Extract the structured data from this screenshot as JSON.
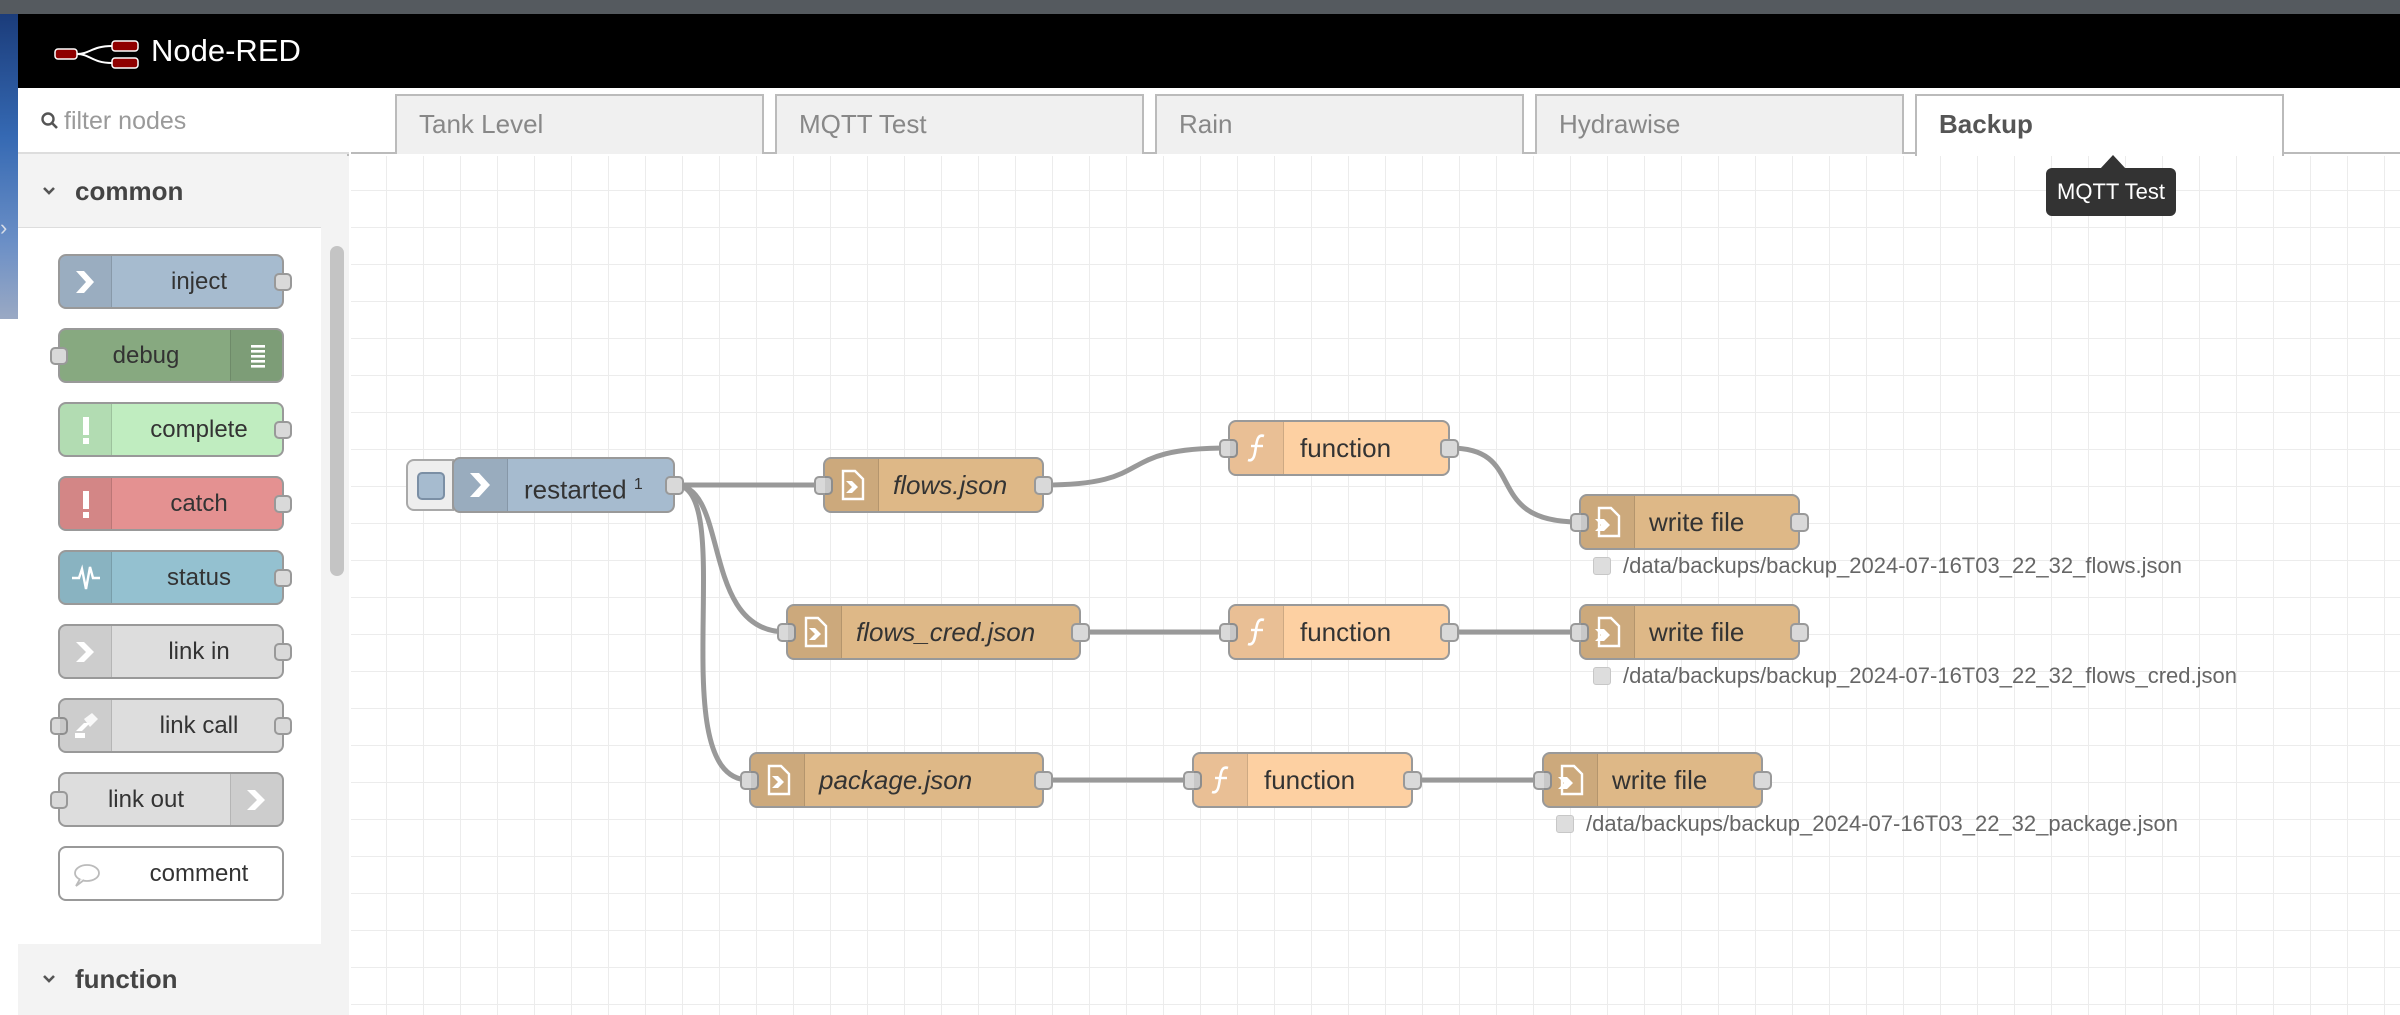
{
  "app": {
    "title": "Node-RED"
  },
  "palette": {
    "filter_placeholder": "filter nodes",
    "categories": [
      {
        "label": "common"
      },
      {
        "label": "function"
      }
    ],
    "nodes": [
      {
        "label": "inject",
        "color": "#a6bbcf",
        "icon": "arrow-in-icon"
      },
      {
        "label": "debug",
        "color": "#87a980",
        "icon": "list-icon"
      },
      {
        "label": "complete",
        "color": "#c0edc0",
        "icon": "exclamation-icon"
      },
      {
        "label": "catch",
        "color": "#e49191",
        "icon": "exclamation-icon"
      },
      {
        "label": "status",
        "color": "#94c1d0",
        "icon": "pulse-icon"
      },
      {
        "label": "link in",
        "color": "#dddddd",
        "icon": "link-in-icon"
      },
      {
        "label": "link call",
        "color": "#dddddd",
        "icon": "link-call-icon"
      },
      {
        "label": "link out",
        "color": "#dddddd",
        "icon": "link-out-icon"
      },
      {
        "label": "comment",
        "color": "#ffffff",
        "icon": "speech-bubble-icon"
      }
    ]
  },
  "tabs": [
    {
      "label": "Tank Level",
      "active": false
    },
    {
      "label": "MQTT Test",
      "active": false
    },
    {
      "label": "Rain",
      "active": false
    },
    {
      "label": "Hydrawise",
      "active": false
    },
    {
      "label": "Backup",
      "active": true
    }
  ],
  "tooltip": {
    "text": "MQTT Test"
  },
  "flow": {
    "nodes": [
      {
        "id": "restarted",
        "label": "restarted",
        "superscript": "1",
        "type": "inject",
        "color": "#a6bbcf",
        "icon": "arrow-in-icon"
      },
      {
        "id": "flows_json",
        "label": "flows.json",
        "type": "file in",
        "color": "#deb887",
        "icon": "file-in-icon"
      },
      {
        "id": "flows_cred_json",
        "label": "flows_cred.json",
        "type": "file in",
        "color": "#deb887",
        "icon": "file-in-icon"
      },
      {
        "id": "package_json",
        "label": "package.json",
        "type": "file in",
        "color": "#deb887",
        "icon": "file-in-icon"
      },
      {
        "id": "function_1",
        "label": "function",
        "type": "function",
        "color": "#fdd0a2",
        "icon": "function-icon"
      },
      {
        "id": "function_2",
        "label": "function",
        "type": "function",
        "color": "#fdd0a2",
        "icon": "function-icon"
      },
      {
        "id": "function_3",
        "label": "function",
        "type": "function",
        "color": "#fdd0a2",
        "icon": "function-icon"
      },
      {
        "id": "write_1",
        "label": "write file",
        "type": "file",
        "color": "#deb887",
        "icon": "file-out-icon",
        "status": "/data/backups/backup_2024-07-16T03_22_32_flows.json"
      },
      {
        "id": "write_2",
        "label": "write file",
        "type": "file",
        "color": "#deb887",
        "icon": "file-out-icon",
        "status": "/data/backups/backup_2024-07-16T03_22_32_flows_cred.json"
      },
      {
        "id": "write_3",
        "label": "write file",
        "type": "file",
        "color": "#deb887",
        "icon": "file-out-icon",
        "status": "/data/backups/backup_2024-07-16T03_22_32_package.json"
      }
    ]
  }
}
